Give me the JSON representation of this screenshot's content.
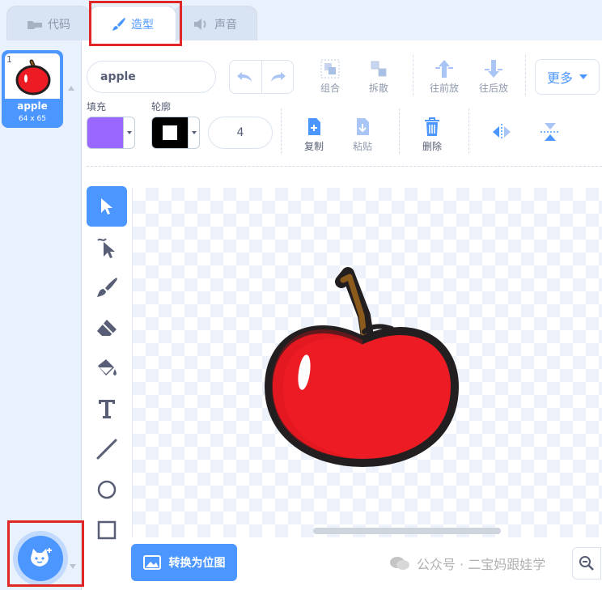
{
  "tabs": [
    {
      "label": "代码",
      "icon": "code-icon",
      "active": false
    },
    {
      "label": "造型",
      "icon": "brush-icon",
      "active": true
    },
    {
      "label": "声音",
      "icon": "speaker-icon",
      "active": false
    }
  ],
  "costume_list": {
    "items": [
      {
        "index": "1",
        "name": "apple",
        "size": "64 x 65",
        "selected": true
      }
    ],
    "add_button_icon": "cat-plus-icon"
  },
  "editor": {
    "costume_name": "apple",
    "toolbar": {
      "group_label": "组合",
      "ungroup_label": "拆散",
      "forward_label": "往前放",
      "backward_label": "往后放",
      "more_label": "更多",
      "fill_label": "填充",
      "outline_label": "轮廓",
      "outline_width": "4",
      "copy_label": "复制",
      "paste_label": "粘贴",
      "delete_label": "删除"
    },
    "colors": {
      "fill": "#9966ff",
      "outline": "#000000",
      "accent": "#4c97ff",
      "highlight_box": "#e02626"
    },
    "tools": [
      "select-icon",
      "reshape-icon",
      "brush-icon",
      "eraser-icon",
      "fill-icon",
      "text-icon",
      "line-icon",
      "circle-icon",
      "rectangle-icon"
    ],
    "convert_button_label": "转换为位图",
    "watermark": "公众号 · 二宝妈跟娃学"
  }
}
